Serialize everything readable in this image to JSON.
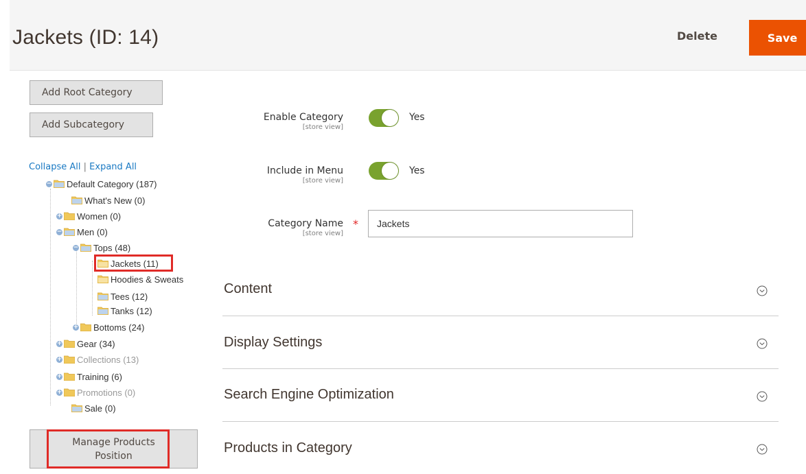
{
  "header": {
    "title": "Jackets (ID: 14)",
    "delete_label": "Delete",
    "save_label": "Save"
  },
  "sidebar": {
    "add_root_label": "Add Root Category",
    "add_sub_label": "Add Subcategory",
    "collapse_all": "Collapse All",
    "separator": "|",
    "expand_all": "Expand All",
    "tree": [
      {
        "label": "Default Category (187)"
      },
      {
        "label": "What's New (0)"
      },
      {
        "label": "Women (0)"
      },
      {
        "label": "Men (0)"
      },
      {
        "label": "Tops (48)"
      },
      {
        "label": "Jackets (11)"
      },
      {
        "label": "Hoodies & Sweats"
      },
      {
        "label": "Tees (12)"
      },
      {
        "label": "Tanks (12)"
      },
      {
        "label": "Bottoms (24)"
      },
      {
        "label": "Gear (34)"
      },
      {
        "label": "Collections (13)"
      },
      {
        "label": "Training (6)"
      },
      {
        "label": "Promotions (0)"
      },
      {
        "label": "Sale (0)"
      }
    ],
    "manage_label": "Manage Products Position"
  },
  "form": {
    "enable": {
      "label": "Enable Category",
      "scope": "[store view]",
      "value": "Yes"
    },
    "menu": {
      "label": "Include in Menu",
      "scope": "[store view]",
      "value": "Yes"
    },
    "name": {
      "label": "Category Name",
      "scope": "[store view]",
      "value": "Jackets",
      "required": "*"
    }
  },
  "sections": [
    {
      "title": "Content"
    },
    {
      "title": "Display Settings"
    },
    {
      "title": "Search Engine Optimization"
    },
    {
      "title": "Products in Category"
    }
  ],
  "colors": {
    "accent": "#eb5202",
    "toggle_on": "#79a22e",
    "highlight": "#e02b27",
    "link": "#1979c3"
  }
}
